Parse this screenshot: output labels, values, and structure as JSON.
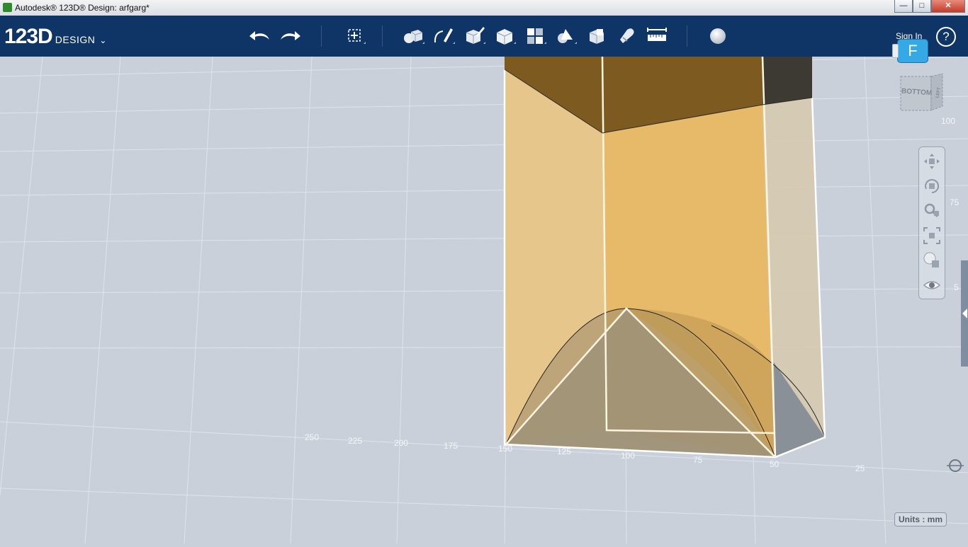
{
  "window": {
    "title": "Autodesk® 123D® Design: arfgarg*",
    "minimize_glyph": "—",
    "restore_glyph": "□",
    "close_glyph": "✕"
  },
  "toolbar": {
    "logo_main": "123D",
    "logo_sub": "DESIGN",
    "logo_chevron": "⌄",
    "sign_in": "Sign In",
    "help": "?",
    "tools": [
      "undo",
      "redo",
      "transform",
      "primitives",
      "sketch",
      "construct",
      "modify",
      "pattern",
      "grouping",
      "combine",
      "snap",
      "measure",
      "material"
    ]
  },
  "user": {
    "badge": "F"
  },
  "viewcube": {
    "face_front": "BOTTOM",
    "face_side": "LEFT"
  },
  "navigation": {
    "tools": [
      "pan-icon",
      "orbit-icon",
      "zoom-icon",
      "fit-icon",
      "view-mode-icon",
      "visibility-icon"
    ]
  },
  "grid_labels": {
    "bottom": [
      "250",
      "225",
      "200",
      "175",
      "150",
      "125",
      "100",
      "75",
      "50",
      "25"
    ],
    "right": [
      "100",
      "75",
      "5"
    ]
  },
  "status": {
    "units": "Units : mm"
  },
  "colors": {
    "toolbar_bg": "#0f3566",
    "viewport_bg": "#c9d0da",
    "solid_fill": "#f2b949",
    "edge_highlight": "#ffffff",
    "user_badge": "#35a9e6"
  }
}
